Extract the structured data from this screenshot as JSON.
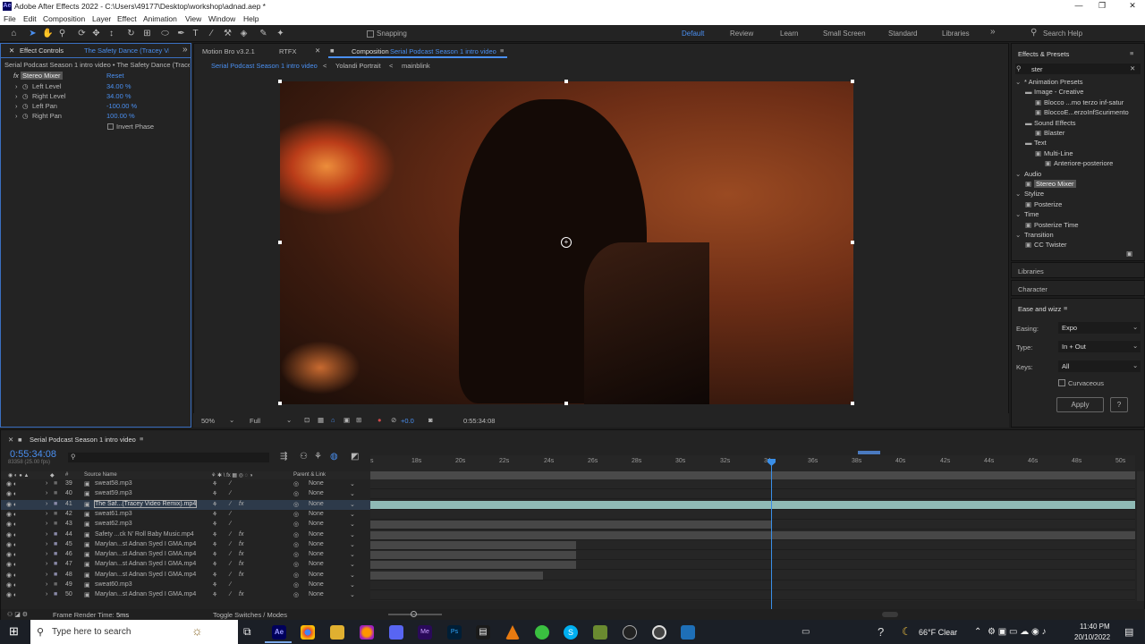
{
  "window": {
    "title": "Adobe After Effects 2022 - C:\\Users\\49177\\Desktop\\workshop\\adnad.aep *",
    "logo": "Ae"
  },
  "menu": [
    "File",
    "Edit",
    "Composition",
    "Layer",
    "Effect",
    "Animation",
    "View",
    "Window",
    "Help"
  ],
  "toolbar": {
    "snapping": "Snapping",
    "workspaces": [
      "Default",
      "Review",
      "Learn",
      "Small Screen",
      "Standard",
      "Libraries"
    ],
    "search": "Search Help"
  },
  "effect_controls": {
    "tab": "Effect Controls",
    "tab_layer": "The Safety Dance (Tracey Vi",
    "breadcrumb": "Serial Podcast Season 1 intro video • The Safety Dance (Tracey",
    "fx_label": "fx",
    "effect_name": "Stereo Mixer",
    "reset": "Reset",
    "params": [
      {
        "name": "Left Level",
        "value": "34.00 %"
      },
      {
        "name": "Right Level",
        "value": "34.00 %"
      },
      {
        "name": "Left Pan",
        "value": "-100.00 %"
      },
      {
        "name": "Right Pan",
        "value": "100.00 %"
      }
    ],
    "invert_phase": "Invert Phase"
  },
  "comp_tabs": {
    "motion_bro": "Motion Bro v3.2.1",
    "rtfx": "RTFX",
    "composition_label": "Composition",
    "composition_name": "Serial Podcast Season 1 intro video"
  },
  "comp_breadcrumbs": [
    "Serial Podcast Season 1 intro video",
    "Yolandi Portrait",
    "mainblink"
  ],
  "viewer_footer": {
    "zoom": "50%",
    "quality": "Full",
    "exposure": "+0.0",
    "timecode": "0:55:34:08"
  },
  "effects_presets": {
    "title": "Effects & Presets",
    "search": "ster",
    "tree": [
      {
        "label": "* Animation Presets",
        "level": 0
      },
      {
        "label": "Image - Creative",
        "level": 1
      },
      {
        "label": "Blocco ...mo terzo inf-satur",
        "level": 2
      },
      {
        "label": "BloccoE...erzoInfScurimento",
        "level": 2
      },
      {
        "label": "Sound Effects",
        "level": 1
      },
      {
        "label": "Blaster",
        "level": 2
      },
      {
        "label": "Text",
        "level": 1
      },
      {
        "label": "Multi-Line",
        "level": 2
      },
      {
        "label": "Anteriore-posteriore",
        "level": 3
      },
      {
        "label": "Audio",
        "level": 0
      },
      {
        "label": "Stereo Mixer",
        "level": 1
      },
      {
        "label": "Stylize",
        "level": 0
      },
      {
        "label": "Posterize",
        "level": 1
      },
      {
        "label": "Time",
        "level": 0
      },
      {
        "label": "Posterize Time",
        "level": 1
      },
      {
        "label": "Transition",
        "level": 0
      },
      {
        "label": "CC Twister",
        "level": 1
      }
    ]
  },
  "side_panels": {
    "libraries": "Libraries",
    "character": "Character"
  },
  "ease_wizz": {
    "title": "Ease and wizz",
    "easing_label": "Easing:",
    "easing": "Expo",
    "type_label": "Type:",
    "type": "In + Out",
    "keys_label": "Keys:",
    "keys": "All",
    "curvaceous": "Curvaceous",
    "apply": "Apply",
    "help": "?"
  },
  "timeline": {
    "comp_tab": "Serial Podcast Season 1 intro video",
    "timecode": "0:55:34:08",
    "frames": "83358 (25.00 fps)",
    "col_num": "#",
    "col_source": "Source Name",
    "col_parent": "Parent & Link",
    "ruler": [
      "s",
      "18s",
      "20s",
      "22s",
      "24s",
      "26s",
      "28s",
      "30s",
      "32s",
      "34s",
      "36s",
      "38s",
      "40s",
      "42s",
      "44s",
      "46s",
      "48s",
      "50s"
    ],
    "layers": [
      {
        "num": "39",
        "name": "sweat58.mp3",
        "parent": "None"
      },
      {
        "num": "40",
        "name": "sweat59.mp3",
        "parent": "None"
      },
      {
        "num": "41",
        "name": "The Saf...(Tracey Video Remix).mp4",
        "parent": "None"
      },
      {
        "num": "42",
        "name": "sweat61.mp3",
        "parent": "None"
      },
      {
        "num": "43",
        "name": "sweat62.mp3",
        "parent": "None"
      },
      {
        "num": "44",
        "name": "Safety ...ck N' Roll Baby Music.mp4",
        "parent": "None"
      },
      {
        "num": "45",
        "name": "Marylan...st Adnan Syed I GMA.mp4",
        "parent": "None"
      },
      {
        "num": "46",
        "name": "Marylan...st Adnan Syed I GMA.mp4",
        "parent": "None"
      },
      {
        "num": "47",
        "name": "Marylan...st Adnan Syed I GMA.mp4",
        "parent": "None"
      },
      {
        "num": "48",
        "name": "Marylan...st Adnan Syed I GMA.mp4",
        "parent": "None"
      },
      {
        "num": "49",
        "name": "sweat60.mp3",
        "parent": "None"
      },
      {
        "num": "50",
        "name": "Marylan...st Adnan Syed I GMA.mp4",
        "parent": "None"
      }
    ],
    "render_time_label": "Frame Render Time:",
    "render_time": "5ms",
    "toggle": "Toggle Switches / Modes"
  },
  "taskbar": {
    "search": "Type here to search",
    "weather": "66°F  Clear",
    "time": "11:40 PM",
    "date": "20/10/2022"
  },
  "colors": {
    "accent": "#4a8ff0",
    "selected_bar": "#8fbab5",
    "playhead": "#3a8fe8"
  }
}
